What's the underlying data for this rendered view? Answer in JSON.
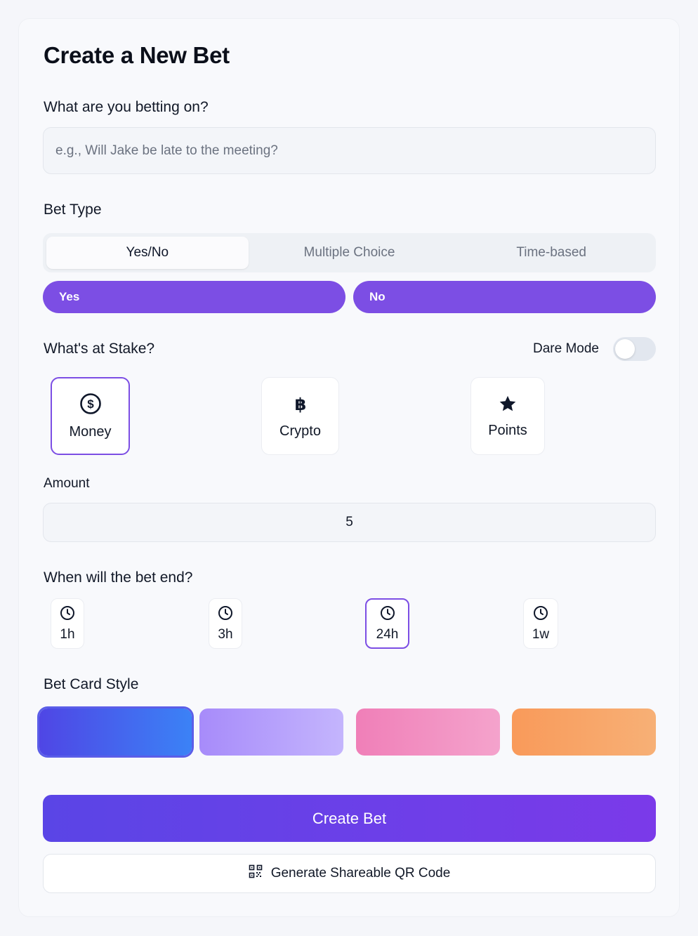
{
  "page": {
    "title": "Create a New Bet"
  },
  "question": {
    "label": "What are you betting on?",
    "placeholder": "e.g., Will Jake be late to the meeting?",
    "value": ""
  },
  "bet_type": {
    "label": "Bet Type",
    "tabs": [
      {
        "label": "Yes/No",
        "active": true
      },
      {
        "label": "Multiple Choice",
        "active": false
      },
      {
        "label": "Time-based",
        "active": false
      }
    ],
    "choices": [
      "Yes",
      "No"
    ]
  },
  "stake": {
    "label": "What's at Stake?",
    "dare_mode_label": "Dare Mode",
    "dare_mode_on": false,
    "options": [
      {
        "label": "Money",
        "icon": "dollar-circle-icon",
        "selected": true
      },
      {
        "label": "Crypto",
        "icon": "bitcoin-icon",
        "selected": false
      },
      {
        "label": "Points",
        "icon": "star-icon",
        "selected": false
      }
    ],
    "amount_label": "Amount",
    "amount_value": "5"
  },
  "end": {
    "label": "When will the bet end?",
    "options": [
      {
        "label": "1h",
        "icon": "clock-icon",
        "selected": false
      },
      {
        "label": "3h",
        "icon": "clock-icon",
        "selected": false
      },
      {
        "label": "24h",
        "icon": "clock-icon",
        "selected": true
      },
      {
        "label": "1w",
        "icon": "clock-icon",
        "selected": false
      }
    ]
  },
  "style": {
    "label": "Bet Card Style",
    "swatches": [
      {
        "from": "#4f46e5",
        "to": "#3b82f6",
        "selected": true
      },
      {
        "from": "#a78bfa",
        "to": "#c4b5fd",
        "selected": false
      },
      {
        "from": "#f07fb8",
        "to": "#f4a3cc",
        "selected": false
      },
      {
        "from": "#f99a5a",
        "to": "#f7b076",
        "selected": false
      }
    ]
  },
  "actions": {
    "create_label": "Create Bet",
    "qr_label": "Generate Shareable QR Code",
    "qr_icon": "qr-code-icon"
  },
  "colors": {
    "accent": "#7c4ee4",
    "primary_gradient_start": "#5a45e6",
    "primary_gradient_end": "#7b3ae9"
  }
}
